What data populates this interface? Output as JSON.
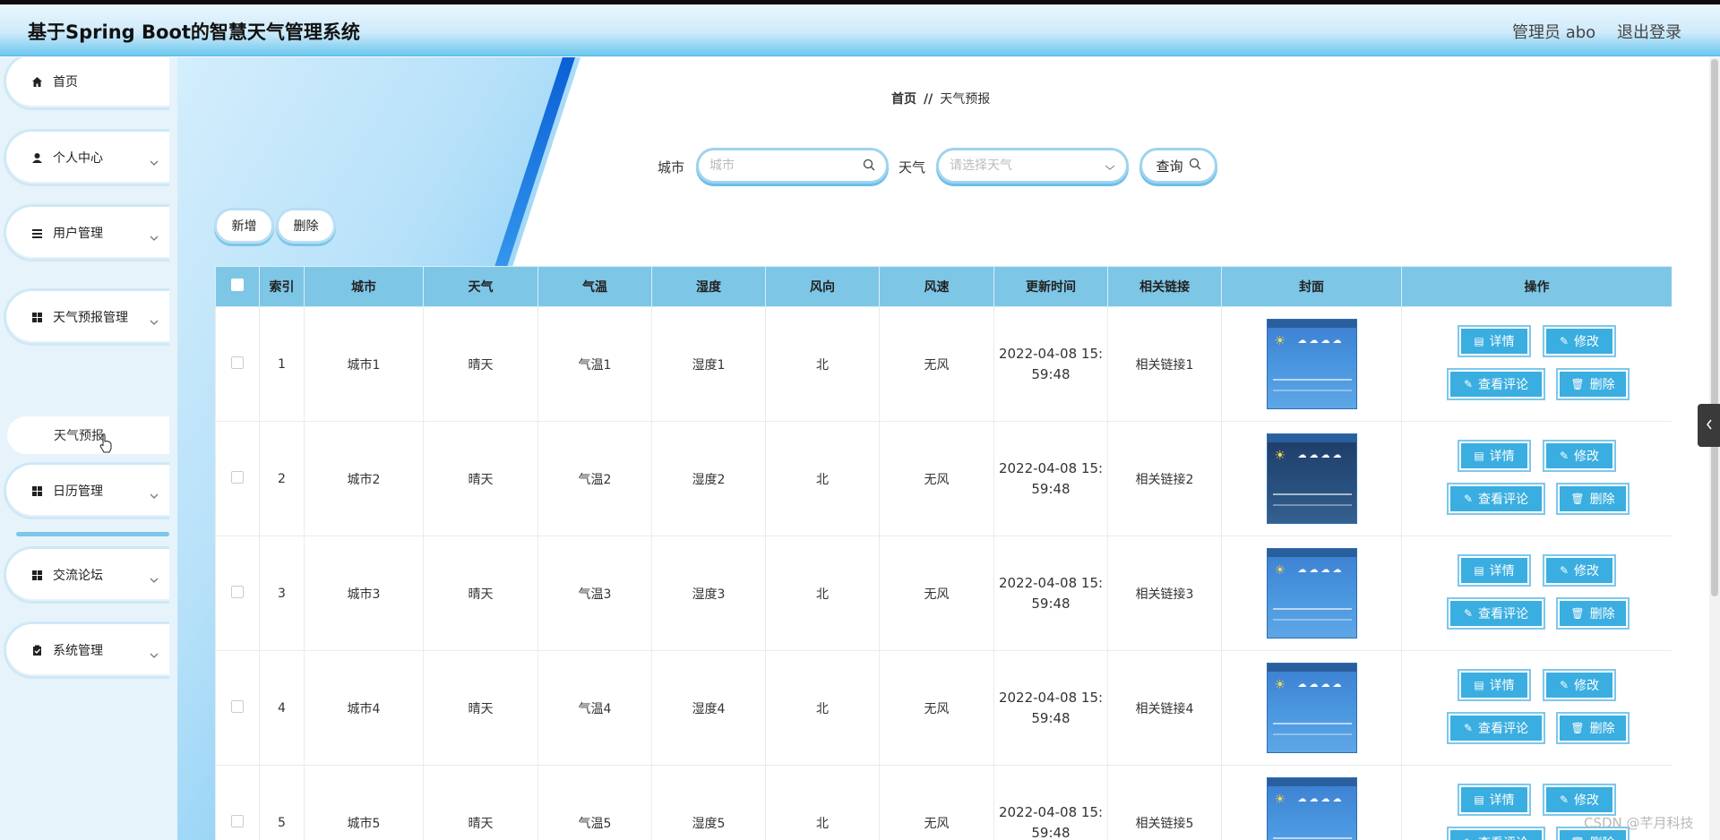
{
  "header": {
    "title": "基于Spring Boot的智慧天气管理系统",
    "admin": "管理员 abo",
    "logout": "退出登录"
  },
  "sidebar": {
    "items": [
      {
        "label": "首页",
        "icon": "home-icon"
      },
      {
        "label": "个人中心",
        "icon": "user-icon"
      },
      {
        "label": "用户管理",
        "icon": "list-icon"
      },
      {
        "label": "天气预报管理",
        "icon": "grid-icon"
      },
      {
        "label": "日历管理",
        "icon": "grid-icon"
      },
      {
        "label": "交流论坛",
        "icon": "grid-icon"
      },
      {
        "label": "系统管理",
        "icon": "clipboard-icon"
      }
    ],
    "sub_item": "天气预报"
  },
  "breadcrumb": {
    "home": "首页",
    "sep": "//",
    "current": "天气预报"
  },
  "search": {
    "city_label": "城市",
    "city_placeholder": "城市",
    "weather_label": "天气",
    "weather_placeholder": "请选择天气",
    "query_label": "查询"
  },
  "actions": {
    "add": "新增",
    "delete": "删除"
  },
  "table": {
    "headers": [
      "索引",
      "城市",
      "天气",
      "气温",
      "湿度",
      "风向",
      "风速",
      "更新时间",
      "相关链接",
      "封面",
      "操作"
    ],
    "ops": {
      "detail": "详情",
      "edit": "修改",
      "review": "查看评论",
      "delete": "删除"
    },
    "rows": [
      {
        "index": "1",
        "city": "城市1",
        "weather": "晴天",
        "temp": "气温1",
        "humidity": "湿度1",
        "wind_dir": "北",
        "wind_speed": "无风",
        "time1": "2022-04-08 15:",
        "time2": "59:48",
        "link": "相关链接1"
      },
      {
        "index": "2",
        "city": "城市2",
        "weather": "晴天",
        "temp": "气温2",
        "humidity": "湿度2",
        "wind_dir": "北",
        "wind_speed": "无风",
        "time1": "2022-04-08 15:",
        "time2": "59:48",
        "link": "相关链接2"
      },
      {
        "index": "3",
        "city": "城市3",
        "weather": "晴天",
        "temp": "气温3",
        "humidity": "湿度3",
        "wind_dir": "北",
        "wind_speed": "无风",
        "time1": "2022-04-08 15:",
        "time2": "59:48",
        "link": "相关链接3"
      },
      {
        "index": "4",
        "city": "城市4",
        "weather": "晴天",
        "temp": "气温4",
        "humidity": "湿度4",
        "wind_dir": "北",
        "wind_speed": "无风",
        "time1": "2022-04-08 15:",
        "time2": "59:48",
        "link": "相关链接4"
      },
      {
        "index": "5",
        "city": "城市5",
        "weather": "晴天",
        "temp": "气温5",
        "humidity": "湿度5",
        "wind_dir": "北",
        "wind_speed": "无风",
        "time1": "2022-04-08 15:",
        "time2": "59:48",
        "link": "相关链接5"
      }
    ]
  },
  "watermark": "CSDN @芊月科技",
  "colors": {
    "accent": "#3aaee0",
    "header_th": "#7ec6e6"
  }
}
